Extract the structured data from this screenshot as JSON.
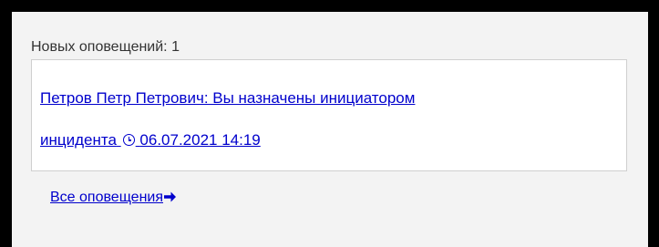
{
  "notifications_panel": {
    "new_count_label": "Новых оповещений: 1",
    "items": [
      {
        "text_line1": "Петров Петр Петрович: Вы назначены инициатором",
        "text_line2": "инцидента",
        "timestamp": "06.07.2021 14:19",
        "time_icon": "clock-icon"
      }
    ],
    "all_link": {
      "label": "Все оповещения",
      "icon": "arrow-right-icon"
    }
  },
  "colors": {
    "link": "#0000cc",
    "frame": "#000000",
    "panel_background": "#f3f3f3",
    "card_background": "#ffffff",
    "card_border": "#cfcfcf",
    "text": "#333333"
  }
}
